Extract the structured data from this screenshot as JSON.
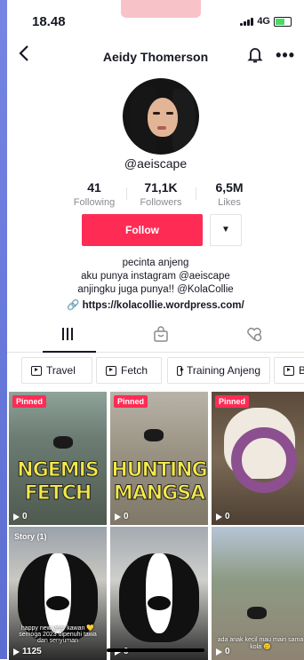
{
  "status_bar": {
    "time": "18.48",
    "network": "4G"
  },
  "header": {
    "title": "Aeidy Thomerson",
    "back_icon": "chevron-left-icon",
    "bell_icon": "bell-icon",
    "more_icon": "more-icon",
    "more_glyph": "•••"
  },
  "profile": {
    "username": "@aeiscape",
    "stats": [
      {
        "value": "41",
        "label": "Following"
      },
      {
        "value": "71,1K",
        "label": "Followers"
      },
      {
        "value": "6,5M",
        "label": "Likes"
      }
    ],
    "follow_label": "Follow",
    "bio": [
      "pecinta anjeng",
      "aku punya instagram @aeiscape",
      "anjingku juga punya!! @KolaCollie"
    ],
    "link": "https://kolacollie.wordpress.com/"
  },
  "tabs": [
    {
      "icon": "grid-icon",
      "active": true
    },
    {
      "icon": "bag-icon",
      "active": false
    },
    {
      "icon": "liked-icon",
      "active": false
    }
  ],
  "playlists": [
    "Travel",
    "Fetch",
    "Training Anjeng",
    "Ba"
  ],
  "videos": [
    {
      "badge": "Pinned",
      "caption_lines": [
        "NGEMIS",
        "FETCH"
      ],
      "views": "0"
    },
    {
      "badge": "Pinned",
      "caption_lines": [
        "HUNTING",
        "MANGSA"
      ],
      "views": "0"
    },
    {
      "badge": "Pinned",
      "caption_lines": [],
      "views": "0"
    },
    {
      "badge": "Story (1)",
      "overlay": "happy new year kawan 💛 semoga 2023 dipenuhi tawa dan senyuman",
      "views": "1125"
    },
    {
      "badge": "",
      "overlay": "",
      "views": "0"
    },
    {
      "badge": "",
      "overlay": "ada anak kecil mau main sama kola 🥲",
      "views": "0"
    }
  ],
  "colors": {
    "accent": "#fe2c55",
    "caption_yellow": "#f5e84a"
  }
}
